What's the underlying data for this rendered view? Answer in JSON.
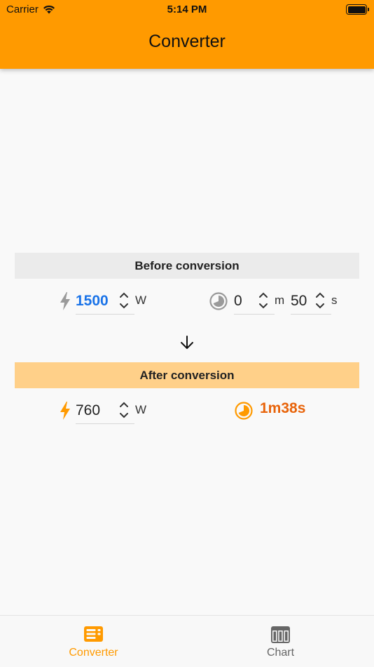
{
  "status_bar": {
    "carrier": "Carrier",
    "time": "5:14 PM"
  },
  "header": {
    "title": "Converter"
  },
  "before": {
    "section_label": "Before conversion",
    "power_value": "1500",
    "power_unit": "W",
    "minutes_value": "0",
    "minutes_unit": "m",
    "seconds_value": "50",
    "seconds_unit": "s"
  },
  "after": {
    "section_label": "After conversion",
    "power_value": "760",
    "power_unit": "W",
    "result_time": "1m38s"
  },
  "tabs": [
    {
      "label": "Converter",
      "icon": "microwave-icon",
      "active": true
    },
    {
      "label": "Chart",
      "icon": "table-chart-icon",
      "active": false
    }
  ],
  "colors": {
    "header": "#ff9a00",
    "accent_blue": "#1a73e8",
    "accent_orange": "#ff9a00",
    "result_text": "#e8640b",
    "after_bar": "#ffd089",
    "before_bar": "#ebebeb",
    "tab_active": "#ff9a00",
    "tab_inactive": "#666666"
  }
}
